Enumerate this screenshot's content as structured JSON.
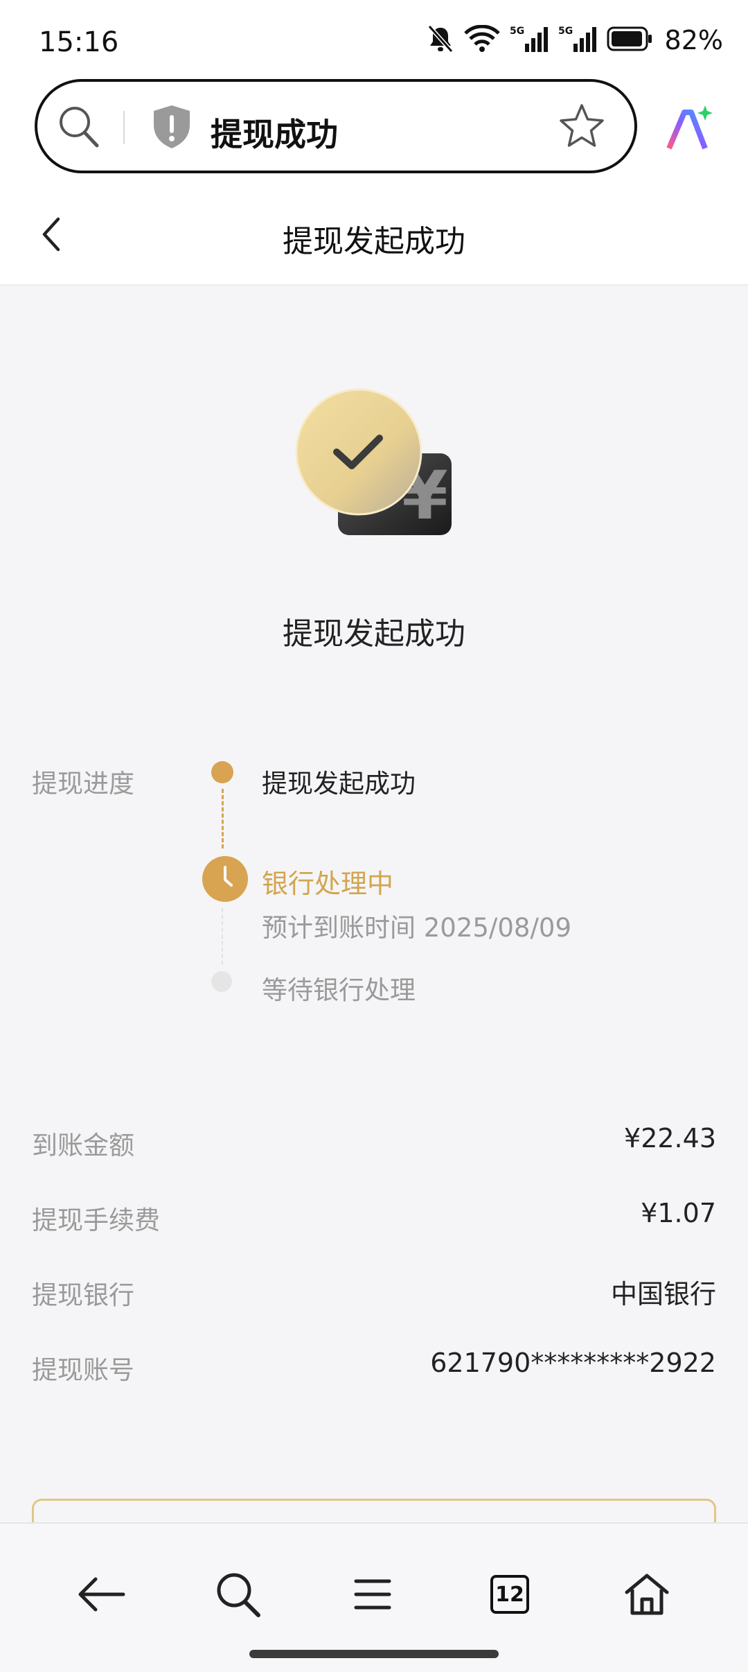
{
  "status_bar": {
    "time": "15:16",
    "battery_percent": "82%",
    "icons": [
      "bell-muted-icon",
      "wifi-icon",
      "signal-5g-icon",
      "signal-5g-icon",
      "battery-icon"
    ]
  },
  "browser": {
    "address_title": "提现成功",
    "tab_count": "12",
    "icons": [
      "search-icon",
      "security-shield-icon",
      "star-icon",
      "ai-assistant-icon"
    ]
  },
  "header": {
    "title": "提现发起成功"
  },
  "hero": {
    "title": "提现发起成功"
  },
  "progress": {
    "label": "提现进度",
    "steps": [
      {
        "text": "提现发起成功",
        "state": "done"
      },
      {
        "text": "银行处理中",
        "sub": "预计到账时间 2025/08/09",
        "state": "current"
      },
      {
        "text": "等待银行处理",
        "state": "pending"
      }
    ]
  },
  "details": {
    "rows": [
      {
        "label": "到账金额",
        "value": "¥22.43"
      },
      {
        "label": "提现手续费",
        "value": "¥1.07"
      },
      {
        "label": "提现银行",
        "value": "中国银行"
      },
      {
        "label": "提现账号",
        "value": "621790*********2922"
      }
    ]
  },
  "bottom_nav": {
    "items": [
      "back-arrow-icon",
      "search-icon",
      "menu-icon",
      "tabs-icon",
      "home-icon"
    ]
  },
  "colors": {
    "accent_gold": "#d8a451",
    "pending_gray": "#e5e5e5",
    "background": "#f5f5f7"
  }
}
